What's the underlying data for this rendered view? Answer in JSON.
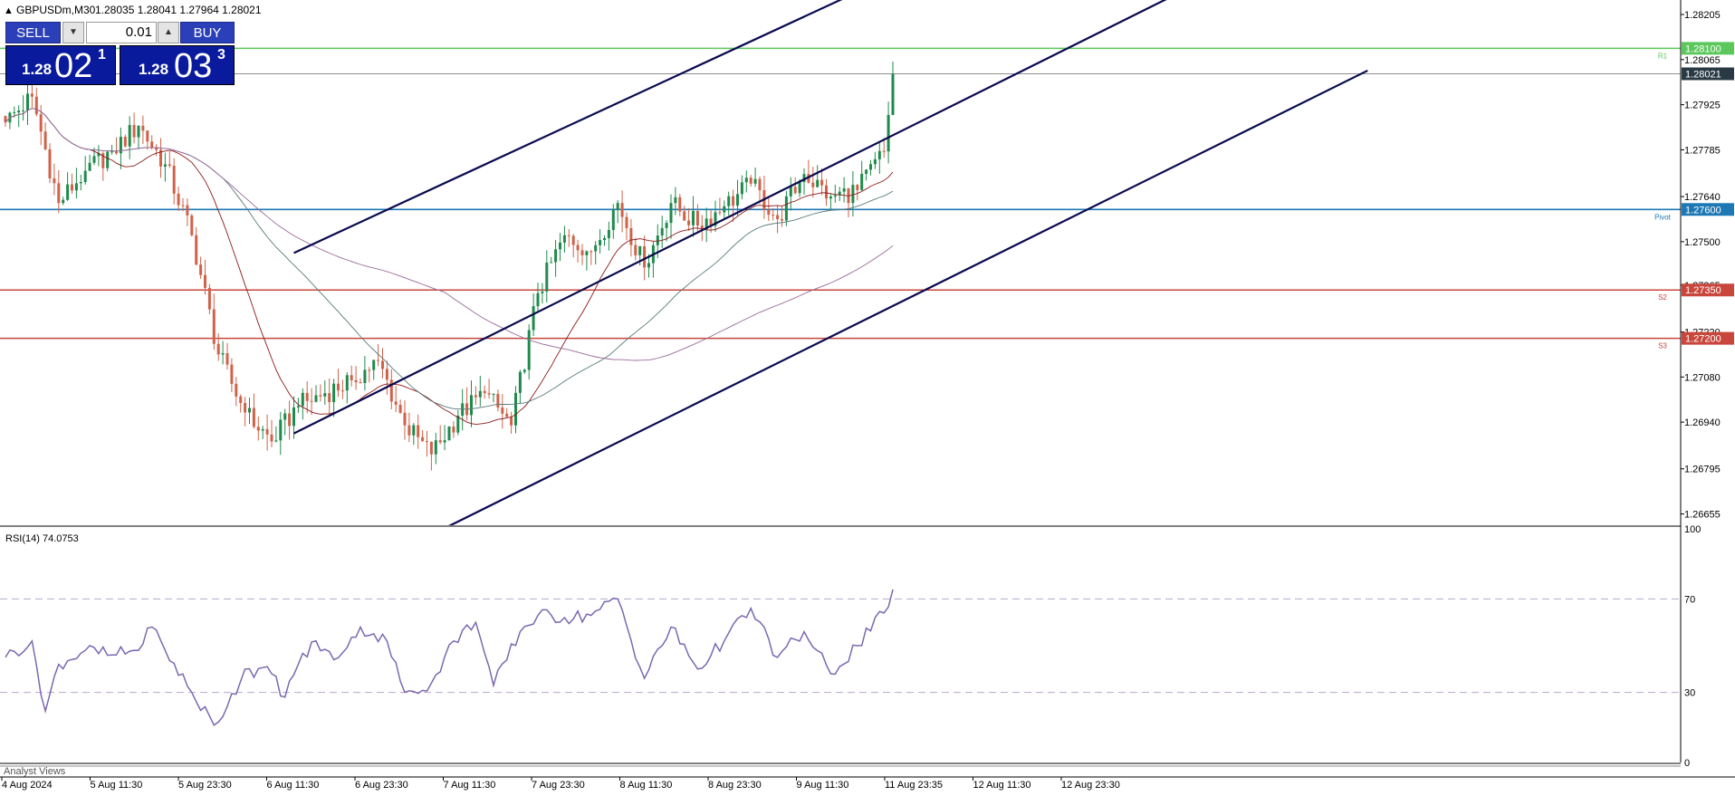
{
  "header": {
    "symbol": "GBPUSDm,M30",
    "ohlc": "1.28035 1.28041 1.27964 1.28021"
  },
  "trade_panel": {
    "sell_label": "SELL",
    "buy_label": "BUY",
    "lot": "0.01",
    "bid_prefix": "1.28",
    "bid_big": "02",
    "bid_sup": "1",
    "ask_prefix": "1.28",
    "ask_big": "03",
    "ask_sup": "3"
  },
  "colors": {
    "bull": "#1f8a4c",
    "bear": "#d0624a",
    "channel": "#0a0a50",
    "r1": "#5cc85c",
    "pivot": "#1e78b4",
    "support": "#c8463c",
    "rsi": "#7b68b0",
    "ma_fast": "#8b1a1a",
    "ma_mid": "#5a7a7a",
    "ma_slow": "#9a6a9a",
    "current_price_bg": "#2a3a44"
  },
  "indicators": {
    "rsi_label": "RSI(14) 74.0753",
    "panel_tab": "Analyst Views"
  },
  "chart_data": [
    {
      "type": "candlestick",
      "symbol": "GBPUSDm",
      "timeframe": "M30",
      "y_ticks": [
        1.26655,
        1.26795,
        1.2694,
        1.2708,
        1.2722,
        1.27365,
        1.275,
        1.2764,
        1.27785,
        1.27925,
        1.28065,
        1.28205
      ],
      "y_tick_labels": [
        "1.26655",
        "1.26795",
        "1.26940",
        "1.27080",
        "1.27220",
        "1.27365",
        "1.27500",
        "1.27640",
        "1.27785",
        "1.27925",
        "1.28065",
        "1.28205"
      ],
      "ylim": [
        1.2662,
        1.2825
      ],
      "x_tick_labels": [
        "4 Aug 2024",
        "5 Aug 11:30",
        "5 Aug 23:30",
        "6 Aug 11:30",
        "6 Aug 23:30",
        "7 Aug 11:30",
        "7 Aug 23:30",
        "8 Aug 11:30",
        "8 Aug 23:30",
        "9 Aug 11:30",
        "11 Aug 23:35",
        "12 Aug 11:30",
        "12 Aug 23:30"
      ],
      "anchors": [
        {
          "bar": 0,
          "price": 1.2787
        },
        {
          "bar": 6,
          "price": 1.2795
        },
        {
          "bar": 12,
          "price": 1.2762
        },
        {
          "bar": 18,
          "price": 1.2772
        },
        {
          "bar": 24,
          "price": 1.2778
        },
        {
          "bar": 30,
          "price": 1.2786
        },
        {
          "bar": 36,
          "price": 1.2774
        },
        {
          "bar": 42,
          "price": 1.2752
        },
        {
          "bar": 48,
          "price": 1.2715
        },
        {
          "bar": 54,
          "price": 1.2697
        },
        {
          "bar": 60,
          "price": 1.2688
        },
        {
          "bar": 66,
          "price": 1.2699
        },
        {
          "bar": 72,
          "price": 1.2703
        },
        {
          "bar": 78,
          "price": 1.2707
        },
        {
          "bar": 84,
          "price": 1.2713
        },
        {
          "bar": 90,
          "price": 1.2693
        },
        {
          "bar": 96,
          "price": 1.2684
        },
        {
          "bar": 102,
          "price": 1.2696
        },
        {
          "bar": 108,
          "price": 1.2703
        },
        {
          "bar": 114,
          "price": 1.2693
        },
        {
          "bar": 120,
          "price": 1.2734
        },
        {
          "bar": 126,
          "price": 1.2752
        },
        {
          "bar": 132,
          "price": 1.2747
        },
        {
          "bar": 138,
          "price": 1.2762
        },
        {
          "bar": 144,
          "price": 1.2742
        },
        {
          "bar": 150,
          "price": 1.2762
        },
        {
          "bar": 156,
          "price": 1.2755
        },
        {
          "bar": 162,
          "price": 1.2761
        },
        {
          "bar": 168,
          "price": 1.2768
        },
        {
          "bar": 174,
          "price": 1.2757
        },
        {
          "bar": 180,
          "price": 1.2771
        },
        {
          "bar": 186,
          "price": 1.2764
        },
        {
          "bar": 192,
          "price": 1.2766
        },
        {
          "bar": 198,
          "price": 1.2778
        },
        {
          "bar": 200,
          "price": 1.28021
        }
      ],
      "bar_count": 201,
      "bar_spacing_px": 4.9,
      "levels": [
        {
          "name": "R1",
          "price": 1.281,
          "label": "1.28100",
          "tag": "R1",
          "color": "#5cc85c"
        },
        {
          "name": "Pivot",
          "price": 1.276,
          "label": "1.27600",
          "tag": "Pivot",
          "color": "#1e78b4"
        },
        {
          "name": "S2",
          "price": 1.2735,
          "label": "1.27350",
          "tag": "S2",
          "color": "#c8463c"
        },
        {
          "name": "S3",
          "price": 1.272,
          "label": "1.27200",
          "tag": "S3",
          "color": "#c8463c"
        }
      ],
      "current_price": {
        "price": 1.28021,
        "label": "1.28021"
      },
      "channel": [
        {
          "from": {
            "bar": 65,
            "price": 1.27465
          },
          "to": {
            "bar": 190,
            "price": 1.28262
          }
        },
        {
          "from": {
            "bar": 65,
            "price": 1.26905
          },
          "to": {
            "bar": 263,
            "price": 1.28262
          }
        },
        {
          "from": {
            "bar": 93,
            "price": 1.2657
          },
          "to": {
            "bar": 307,
            "price": 1.28031
          }
        }
      ],
      "grid": false
    },
    {
      "type": "line",
      "title": "RSI(14) 74.0753",
      "ylim": [
        0,
        100
      ],
      "y_ticks": [
        0,
        30,
        70,
        100
      ],
      "levels": [
        30,
        70
      ],
      "anchors": [
        {
          "bar": 0,
          "value": 45
        },
        {
          "bar": 6,
          "value": 52
        },
        {
          "bar": 9,
          "value": 22
        },
        {
          "bar": 12,
          "value": 42
        },
        {
          "bar": 18,
          "value": 48
        },
        {
          "bar": 24,
          "value": 46
        },
        {
          "bar": 30,
          "value": 48
        },
        {
          "bar": 33,
          "value": 58
        },
        {
          "bar": 36,
          "value": 48
        },
        {
          "bar": 42,
          "value": 30
        },
        {
          "bar": 47,
          "value": 16
        },
        {
          "bar": 50,
          "value": 24
        },
        {
          "bar": 54,
          "value": 40
        },
        {
          "bar": 60,
          "value": 38
        },
        {
          "bar": 63,
          "value": 28
        },
        {
          "bar": 66,
          "value": 42
        },
        {
          "bar": 70,
          "value": 52
        },
        {
          "bar": 74,
          "value": 44
        },
        {
          "bar": 80,
          "value": 58
        },
        {
          "bar": 86,
          "value": 52
        },
        {
          "bar": 90,
          "value": 30
        },
        {
          "bar": 96,
          "value": 34
        },
        {
          "bar": 101,
          "value": 52
        },
        {
          "bar": 106,
          "value": 60
        },
        {
          "bar": 110,
          "value": 33
        },
        {
          "bar": 116,
          "value": 56
        },
        {
          "bar": 120,
          "value": 63
        },
        {
          "bar": 126,
          "value": 62
        },
        {
          "bar": 132,
          "value": 63
        },
        {
          "bar": 138,
          "value": 70
        },
        {
          "bar": 144,
          "value": 36
        },
        {
          "bar": 150,
          "value": 58
        },
        {
          "bar": 156,
          "value": 40
        },
        {
          "bar": 162,
          "value": 52
        },
        {
          "bar": 168,
          "value": 66
        },
        {
          "bar": 174,
          "value": 45
        },
        {
          "bar": 180,
          "value": 56
        },
        {
          "bar": 186,
          "value": 38
        },
        {
          "bar": 192,
          "value": 50
        },
        {
          "bar": 198,
          "value": 64
        },
        {
          "bar": 200,
          "value": 74.08
        }
      ]
    }
  ]
}
